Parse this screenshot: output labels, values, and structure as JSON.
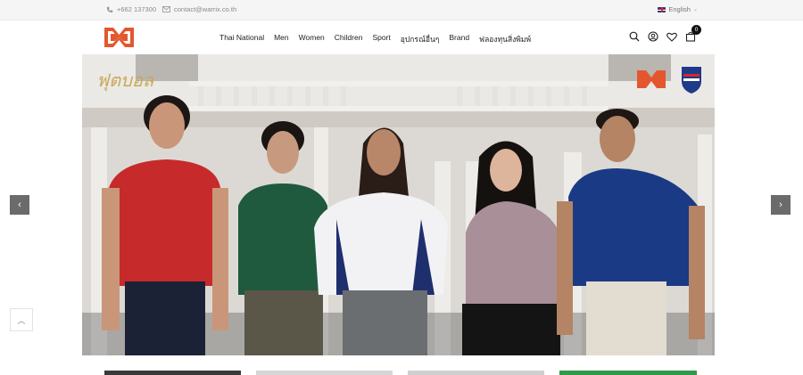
{
  "topbar": {
    "phone": "+662 137300",
    "email": "contact@warrix.co.th",
    "language": "English"
  },
  "header": {
    "logo_name": "warrix-logo",
    "nav": [
      "Thai National",
      "Men",
      "Women",
      "Children",
      "Sport",
      "อุปกรณ์อื่นๆ",
      "Brand",
      "ฟลองทุนสิ่งพิมพ์"
    ],
    "cart_count": "0"
  },
  "hero": {
    "brand_mark_text": "ฟุตบอล",
    "jerseys": [
      "red",
      "green",
      "white-navy",
      "mauve",
      "navy"
    ]
  },
  "colors": {
    "accent": "#e4572e",
    "topbar_bg": "#f5f5f5",
    "arrow_bg": "#6b6b6b"
  }
}
